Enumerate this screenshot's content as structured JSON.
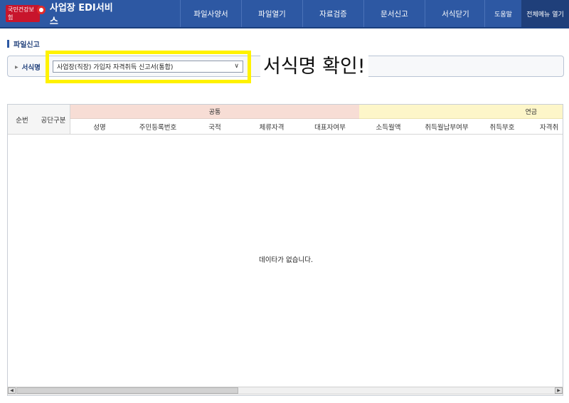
{
  "header": {
    "org_name": "국민건강보험",
    "title": "사업장 EDI서비스",
    "nav": [
      "파일사양서",
      "파일열기",
      "자료검증",
      "문서신고",
      "서식닫기"
    ],
    "help_label": "도움말",
    "all_menu_label": "전체메뉴 열기"
  },
  "page": {
    "title": "파일신고"
  },
  "form": {
    "label": "서식명",
    "selected": "사업장(직장) 가입자 자격취득 신고서(통합)",
    "annotation": "서식명 확인!"
  },
  "grid": {
    "fixed_columns": [
      "순번",
      "공단구분"
    ],
    "groups": {
      "common": "공통",
      "pension": "연금"
    },
    "sub_columns": [
      "성명",
      "주민등록번호",
      "국적",
      "체류자격",
      "대표자여부",
      "소득월액",
      "취득월납부여부",
      "취득부호",
      "자격취"
    ],
    "empty_message": "데이타가 없습니다."
  },
  "colors": {
    "header_bg": "#2d58a3",
    "common_group_bg": "#f7ddd5",
    "pension_group_bg": "#fdf6c9",
    "highlight": "#fff200"
  }
}
